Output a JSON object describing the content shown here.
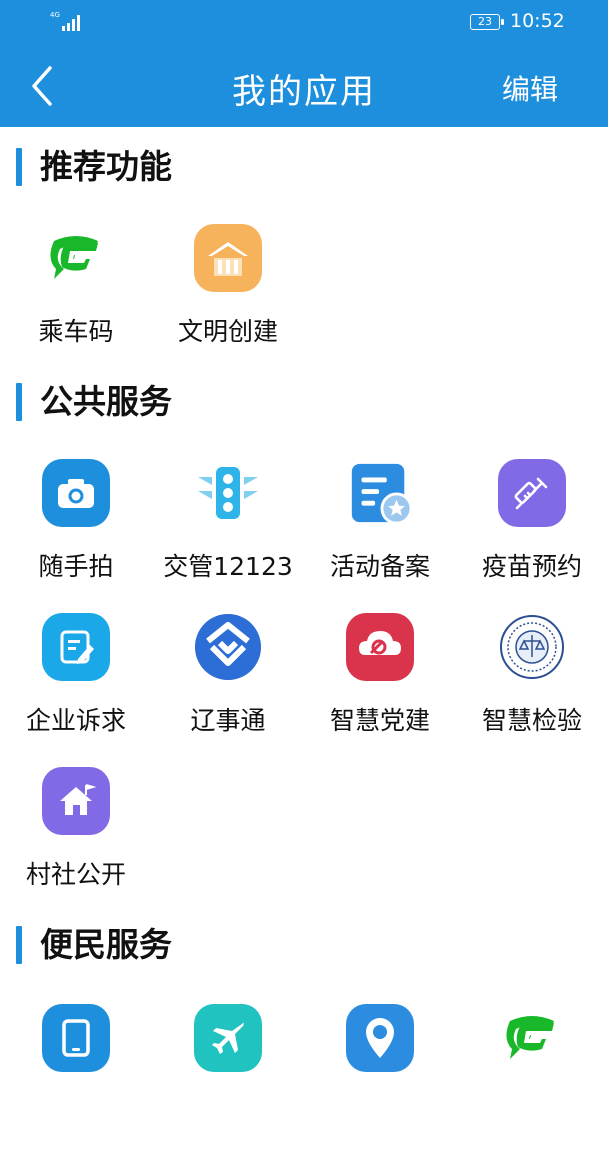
{
  "status_bar": {
    "signal": "4G",
    "battery": "23",
    "time": "10:52"
  },
  "header": {
    "title": "我的应用",
    "edit": "编辑"
  },
  "sections": [
    {
      "title": "推荐功能",
      "apps": [
        {
          "label": "乘车码",
          "icon": "green-g-logo-icon"
        },
        {
          "label": "文明创建",
          "icon": "civilization-house-icon"
        }
      ]
    },
    {
      "title": "公共服务",
      "apps": [
        {
          "label": "随手拍",
          "icon": "camera-icon"
        },
        {
          "label": "交管12123",
          "icon": "traffic-light-icon"
        },
        {
          "label": "活动备案",
          "icon": "document-star-icon"
        },
        {
          "label": "疫苗预约",
          "icon": "syringe-icon"
        },
        {
          "label": "企业诉求",
          "icon": "edit-note-icon"
        },
        {
          "label": "辽事通",
          "icon": "liaoshitong-logo-icon"
        },
        {
          "label": "智慧党建",
          "icon": "party-emblem-icon"
        },
        {
          "label": "智慧检验",
          "icon": "procuratorate-emblem-icon"
        },
        {
          "label": "村社公开",
          "icon": "home-flag-icon"
        }
      ]
    },
    {
      "title": "便民服务",
      "apps": [
        {
          "icon": "tablet-icon"
        },
        {
          "icon": "airplane-icon"
        },
        {
          "icon": "bus-location-icon"
        },
        {
          "icon": "green-g-logo-icon"
        }
      ]
    }
  ],
  "colors": {
    "brand": "#1e8fdd"
  }
}
